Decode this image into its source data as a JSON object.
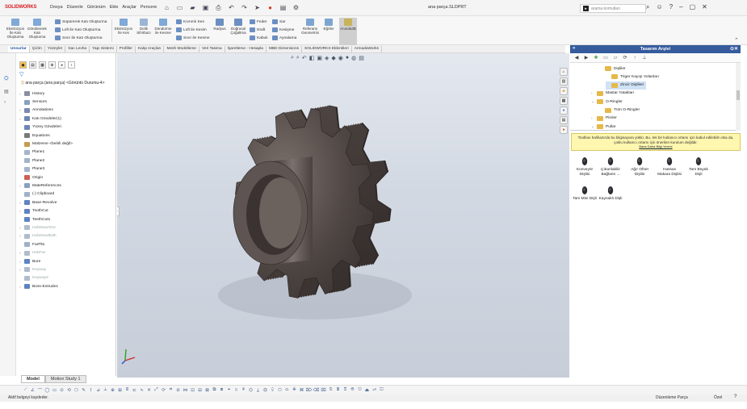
{
  "app": {
    "logo": "SOLIDWORKS",
    "document_title": "ana parça.SLDPRT"
  },
  "menu": [
    "Dosya",
    "Düzenle",
    "Görünüm",
    "Ekle",
    "Araçlar",
    "Pencere"
  ],
  "search": {
    "placeholder": "arama komutları"
  },
  "ribbon": {
    "buttons": [
      {
        "label": "Ekstrüzyon\nİle Katı\nOluşturma",
        "color": "#7fa9d6"
      },
      {
        "label": "Döndürerek\nKatı\nOluşturma",
        "color": "#7fa9d6"
      },
      {
        "label": "Ekstrüzyon\nİle Kes",
        "color": "#7fa9d6"
      },
      {
        "label": "Delik\nSihirbazı",
        "color": "#9bb5d4"
      },
      {
        "label": "Döndürme\nile Kesme",
        "color": "#7fa9d6"
      },
      {
        "label": "Radyus",
        "color": "#6c8fc2"
      },
      {
        "label": "Doğrusal\nÇoğaltma",
        "color": "#6c8fc2"
      },
      {
        "label": "Referans\nGeometrisi",
        "color": "#7da5d0"
      },
      {
        "label": "Eğriler",
        "color": "#7da5d0"
      },
      {
        "label": "Anında3B",
        "color": "#c9b35a"
      }
    ],
    "small": [
      "Süpürerek Katı Oluşturma",
      "Loft ile Katı Oluşturma",
      "Sınır ile Katı Oluşturma",
      "Kıvrımlı Kes",
      "Loft ile Kesim",
      "Sınır ile Kesme",
      "Feder",
      "Draft",
      "Kabuk",
      "Sar",
      "Kesişme",
      "Aynalama"
    ]
  },
  "tabs": [
    "Unsurlar",
    "Çizim",
    "Yüzeyler",
    "Sac Levha",
    "Yapı Sistemi",
    "Profiller",
    "Kalıp Araçları",
    "Mesh Modelleme",
    "Veri Tasima",
    "İşaretleme - Hesapla",
    "MBD Dimensions",
    "SOLIDWORKS Eklentileri",
    "ArmadaWorks"
  ],
  "feature_tree": {
    "root": "ana parça (ana parça) <Görüntü Durumu-4>",
    "nodes": [
      {
        "label": "History",
        "expand": "›",
        "color": "#8a8fa0",
        "dim": false
      },
      {
        "label": "Sensors",
        "expand": "",
        "color": "#8aa0c0",
        "dim": false
      },
      {
        "label": "Annotations",
        "expand": "›",
        "color": "#7a8ab0",
        "dim": false
      },
      {
        "label": "Katı Gövdeler(1)",
        "expand": "›",
        "color": "#6d86b5",
        "dim": false
      },
      {
        "label": "Yüzey Gövdeleri",
        "expand": "",
        "color": "#6d86b5",
        "dim": false
      },
      {
        "label": "Equations",
        "expand": "",
        "color": "#7a7a7a",
        "dim": false
      },
      {
        "label": "Malzeme <belirli değil>",
        "expand": "",
        "color": "#c79b52",
        "dim": false
      },
      {
        "label": "Plane1",
        "expand": "",
        "color": "#a4b4cc",
        "dim": false
      },
      {
        "label": "Plane2",
        "expand": "",
        "color": "#a4b4cc",
        "dim": false
      },
      {
        "label": "Plane3",
        "expand": "",
        "color": "#a4b4cc",
        "dim": false
      },
      {
        "label": "Origin",
        "expand": "",
        "color": "#d06050",
        "dim": false
      },
      {
        "label": "MateReferences",
        "expand": "›",
        "color": "#8aa0c0",
        "dim": false
      },
      {
        "label": "(-) Clipboard",
        "expand": "",
        "color": "#9fb0c8",
        "dim": false
      },
      {
        "label": "Base-Revolve",
        "expand": "›",
        "color": "#5f82c2",
        "dim": false
      },
      {
        "label": "ToothCut",
        "expand": "›",
        "color": "#5f82c2",
        "dim": false
      },
      {
        "label": "TeethCuts",
        "expand": "",
        "color": "#5f82c2",
        "dim": false
      },
      {
        "label": "HubNearOne",
        "expand": "›",
        "color": "#b0bccc",
        "dim": true
      },
      {
        "label": "HubNearBoth",
        "expand": "›",
        "color": "#b0bccc",
        "dim": true
      },
      {
        "label": "FarFlts",
        "expand": "",
        "color": "#9fb0c8",
        "dim": false
      },
      {
        "label": "HubFar",
        "expand": "›",
        "color": "#b0bccc",
        "dim": true
      },
      {
        "label": "Bore",
        "expand": "›",
        "color": "#5f82c2",
        "dim": false
      },
      {
        "label": "Keyway",
        "expand": "›",
        "color": "#b0bccc",
        "dim": true
      },
      {
        "label": "Keyway2",
        "expand": "",
        "color": "#b0bccc",
        "dim": true
      },
      {
        "label": "Boss-Extrude1",
        "expand": "›",
        "color": "#5f82c2",
        "dim": false
      }
    ]
  },
  "bottom_tabs": {
    "model": "Model",
    "motion": "Motion Study 1"
  },
  "design_library": {
    "title": "Tasarım Arşivi",
    "tree": [
      {
        "label": "Dişliler",
        "expand": "",
        "indent": 36,
        "selected": false
      },
      {
        "label": "Triger Kayışı Volanları",
        "expand": "",
        "indent": 44,
        "selected": false
      },
      {
        "label": "Zincir Dişlileri",
        "expand": "",
        "indent": 44,
        "selected": true
      },
      {
        "label": "Mastar Yatakları",
        "expand": "›",
        "indent": 26,
        "selected": false
      },
      {
        "label": "O-Ringler",
        "expand": "⌄",
        "indent": 26,
        "selected": false
      },
      {
        "label": "Tüm O-Ringler",
        "expand": "",
        "indent": 36,
        "selected": false
      },
      {
        "label": "Pimler",
        "expand": "›",
        "indent": 26,
        "selected": false
      },
      {
        "label": "Pullar",
        "expand": "⌄",
        "indent": 26,
        "selected": false
      }
    ],
    "notice": "Toolbox halihazırda bu bilgisayara yüklü. Bu, tek bir kullanıcı ortamı için kabul edilebilir olsa da, çoklu kullanıcı ortamı için önerilen kurulum değildir.",
    "notice_link": "Bana Daha Bilgi Verme",
    "items": [
      "Konveyör Dişlisi",
      "Çıkarılabilir Bağlantı ...",
      "Ağır Ofset Dişlisi",
      "Hassas Makara Dişlisi",
      "Tam Büyük Dişli",
      "Tam Mini Dişli",
      "Kaynaklı Dişli"
    ]
  },
  "status": {
    "left": "Aktif belgeyi kaydeder.",
    "mode": "Düzenleme Parça",
    "units": "Özel",
    "help": "?"
  }
}
